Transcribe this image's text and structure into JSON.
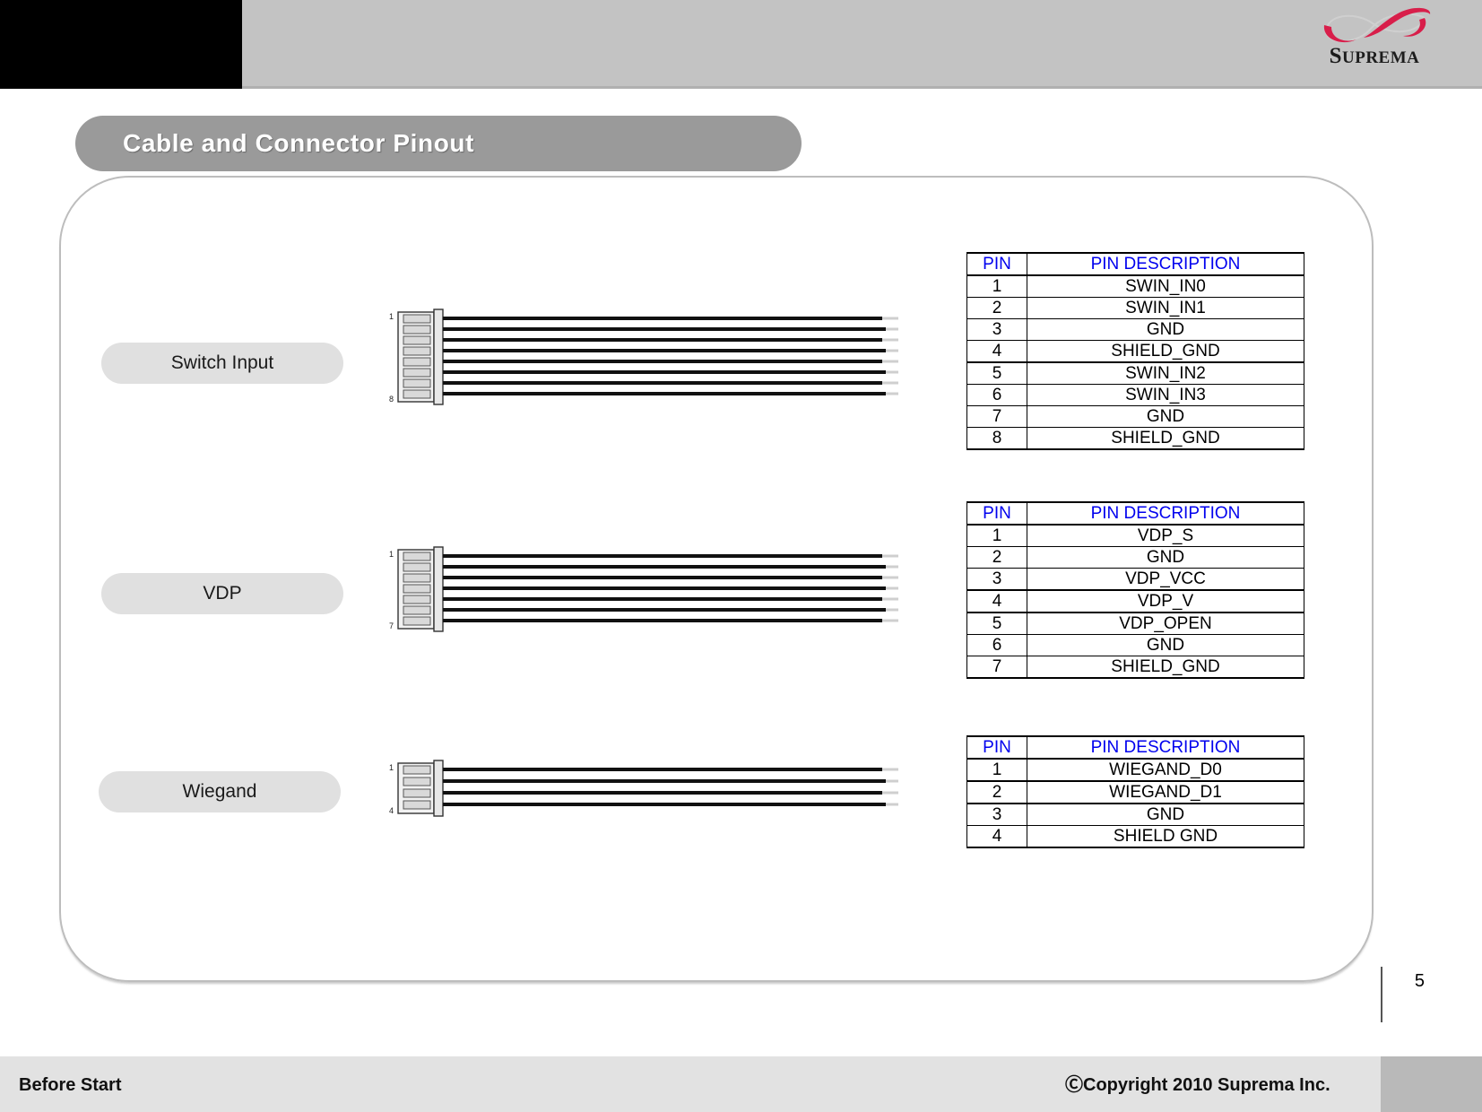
{
  "header": {
    "logo_name": "suprema-logo",
    "logo_text_first": "S",
    "logo_text_rest": "UPREMA"
  },
  "title": {
    "text": "Cable and Connector Pinout"
  },
  "sections": [
    {
      "label": "Switch Input",
      "connector": {
        "wires": 8,
        "first_pin_label": "1",
        "last_pin_label": "8"
      },
      "table": {
        "headers": [
          "PIN",
          "PIN DESCRIPTION"
        ],
        "rows": [
          [
            "1",
            "SWIN_IN0"
          ],
          [
            "2",
            "SWIN_IN1"
          ],
          [
            "3",
            "GND"
          ],
          [
            "4",
            "SHIELD_GND"
          ],
          [
            "5",
            "SWIN_IN2"
          ],
          [
            "6",
            "SWIN_IN3"
          ],
          [
            "7",
            "GND"
          ],
          [
            "8",
            "SHIELD_GND"
          ]
        ]
      }
    },
    {
      "label": "VDP",
      "connector": {
        "wires": 7,
        "first_pin_label": "1",
        "last_pin_label": "7"
      },
      "table": {
        "headers": [
          "PIN",
          "PIN DESCRIPTION"
        ],
        "rows": [
          [
            "1",
            "VDP_S"
          ],
          [
            "2",
            "GND"
          ],
          [
            "3",
            "VDP_VCC"
          ],
          [
            "4",
            "VDP_V"
          ],
          [
            "5",
            "VDP_OPEN"
          ],
          [
            "6",
            "GND"
          ],
          [
            "7",
            "SHIELD_GND"
          ]
        ]
      }
    },
    {
      "label": "Wiegand",
      "connector": {
        "wires": 4,
        "first_pin_label": "1",
        "last_pin_label": "4"
      },
      "table": {
        "headers": [
          "PIN",
          "PIN DESCRIPTION"
        ],
        "rows": [
          [
            "1",
            "WIEGAND_D0"
          ],
          [
            "2",
            "WIEGAND_D1"
          ],
          [
            "3",
            "GND"
          ],
          [
            "4",
            "SHIELD GND"
          ]
        ]
      }
    }
  ],
  "page": {
    "number": "5"
  },
  "footer": {
    "left_text": "Before Start",
    "copyright": "ⒸCopyright 2010 Suprema Inc."
  },
  "colors": {
    "header_band": "#c3c3c3",
    "title_pill": "#9a9a9a",
    "label_pill": "#e0e0e0",
    "table_header_text": "#0000ee",
    "logo_red": "#d81e4a",
    "footer_bg": "#e2e2e2"
  }
}
